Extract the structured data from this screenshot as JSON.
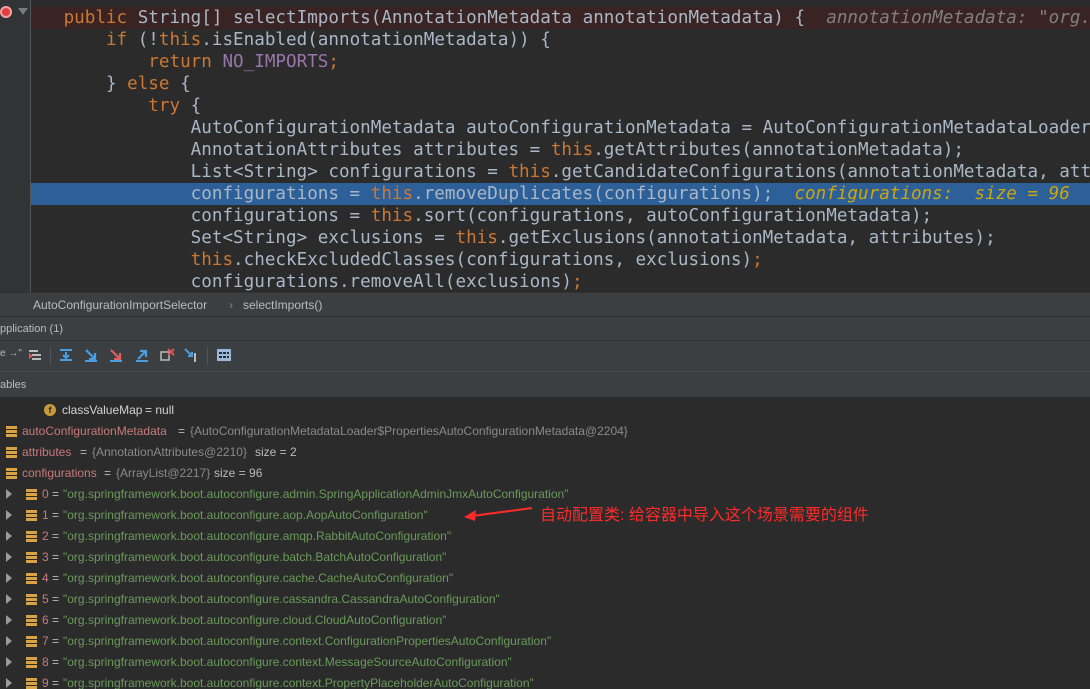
{
  "editor": {
    "lines": [
      {
        "indent": "      ",
        "parts": [
          [
            "kw",
            "public "
          ],
          [
            "",
            "String[] selectImports(AnnotationMetadata annotationMetadata) {  "
          ],
          [
            "hint",
            "annotationMetadata: \"org.springframework.boot.autoconfigure.EnableAutoConfiguration\""
          ]
        ]
      },
      {
        "indent": "          ",
        "parts": [
          [
            "kw",
            "if "
          ],
          [
            "",
            "(!"
          ],
          [
            "kw",
            "this"
          ],
          [
            "",
            ".isEnabled(annotationMetadata)) {"
          ]
        ]
      },
      {
        "indent": "              ",
        "parts": [
          [
            "kw",
            "return "
          ],
          [
            "field",
            "NO_IMPORTS"
          ],
          [
            "kw",
            ";"
          ]
        ]
      },
      {
        "indent": "          ",
        "parts": [
          [
            "",
            "} "
          ],
          [
            "kw",
            "else "
          ],
          [
            "",
            "{"
          ]
        ]
      },
      {
        "indent": "              ",
        "parts": [
          [
            "kw",
            "try "
          ],
          [
            "",
            "{"
          ]
        ]
      },
      {
        "indent": "                  ",
        "parts": [
          [
            "",
            "AutoConfigurationMetadata autoConfigurationMetadata = AutoConfigurationMetadataLoader.loadMetadata("
          ]
        ]
      },
      {
        "indent": "                  ",
        "parts": [
          [
            "",
            "AnnotationAttributes attributes = "
          ],
          [
            "kw",
            "this"
          ],
          [
            "",
            ".getAttributes(annotationMetadata);"
          ]
        ]
      },
      {
        "indent": "                  ",
        "parts": [
          [
            "",
            "List<String> configurations = "
          ],
          [
            "kw",
            "this"
          ],
          [
            "",
            ".getCandidateConfigurations(annotationMetadata, attributes);"
          ]
        ]
      },
      {
        "indent": "                  ",
        "parts": [
          [
            "",
            "configurations = "
          ],
          [
            "kw",
            "this"
          ],
          [
            "",
            ".removeDuplicates(configurations);  "
          ],
          [
            "dbg-val",
            "configurations:  size = 96"
          ]
        ]
      },
      {
        "indent": "                  ",
        "parts": [
          [
            "",
            "configurations = "
          ],
          [
            "kw",
            "this"
          ],
          [
            "",
            ".sort(configurations, autoConfigurationMetadata);"
          ]
        ]
      },
      {
        "indent": "                  ",
        "parts": [
          [
            "",
            "Set<String> exclusions = "
          ],
          [
            "kw",
            "this"
          ],
          [
            "",
            ".getExclusions(annotationMetadata, attributes);"
          ]
        ]
      },
      {
        "indent": "                  ",
        "parts": [
          [
            "kw",
            "this"
          ],
          [
            "",
            ".checkExcludedClasses(configurations, exclusions)"
          ],
          [
            "kw",
            ";"
          ]
        ]
      },
      {
        "indent": "                  ",
        "parts": [
          [
            "",
            "configurations.removeAll(exclusions)"
          ],
          [
            "kw",
            ";"
          ]
        ]
      }
    ]
  },
  "breadcrumb": {
    "class_name": "AutoConfigurationImportSelector",
    "separator": "›",
    "method": "selectImports()"
  },
  "debug_header": {
    "title": "pplication (1)"
  },
  "toolbar": {
    "partial_glyphs": "e →\""
  },
  "variables_header": {
    "title": "ables"
  },
  "variables": {
    "class_value_map": {
      "name": "classValueMap",
      "value": " = null"
    },
    "auto_configuration_metadata": {
      "name": "autoConfigurationMetadata",
      "value": "{AutoConfigurationMetadataLoader$PropertiesAutoConfigurationMetadata@2204}"
    },
    "attributes": {
      "name": "attributes",
      "value": "{AnnotationAttributes@2210}",
      "size": " size = 2"
    },
    "configurations": {
      "name": "configurations",
      "value": "{ArrayList@2217}",
      "size": " size = 96"
    },
    "items": [
      {
        "index": "0",
        "value": "\"org.springframework.boot.autoconfigure.admin.SpringApplicationAdminJmxAutoConfiguration\""
      },
      {
        "index": "1",
        "value": "\"org.springframework.boot.autoconfigure.aop.AopAutoConfiguration\""
      },
      {
        "index": "2",
        "value": "\"org.springframework.boot.autoconfigure.amqp.RabbitAutoConfiguration\""
      },
      {
        "index": "3",
        "value": "\"org.springframework.boot.autoconfigure.batch.BatchAutoConfiguration\""
      },
      {
        "index": "4",
        "value": "\"org.springframework.boot.autoconfigure.cache.CacheAutoConfiguration\""
      },
      {
        "index": "5",
        "value": "\"org.springframework.boot.autoconfigure.cassandra.CassandraAutoConfiguration\""
      },
      {
        "index": "6",
        "value": "\"org.springframework.boot.autoconfigure.cloud.CloudAutoConfiguration\""
      },
      {
        "index": "7",
        "value": "\"org.springframework.boot.autoconfigure.context.ConfigurationPropertiesAutoConfiguration\""
      },
      {
        "index": "8",
        "value": "\"org.springframework.boot.autoconfigure.context.MessageSourceAutoConfiguration\""
      },
      {
        "index": "9",
        "value": "\"org.springframework.boot.autoconfigure.context.PropertyPlaceholderAutoConfiguration\""
      }
    ]
  },
  "annotation": {
    "text": "自动配置类: 给容器中导入这个场景需要的组件",
    "color": "#ff2a2a"
  },
  "colors": {
    "highlight_line": "#2d6099",
    "breakpoint_line": "#3a2323",
    "keyword": "#cc7832",
    "string_value": "#6a9a5a"
  },
  "icons": [
    "breakpoint-icon",
    "fold-icon",
    "step-over-icon",
    "step-into-icon",
    "force-step-into-icon",
    "step-out-icon",
    "drop-frame-icon",
    "run-to-cursor-icon",
    "evaluate-icon",
    "field-icon",
    "object-icon",
    "expand-arrow-icon",
    "red-arrow"
  ]
}
